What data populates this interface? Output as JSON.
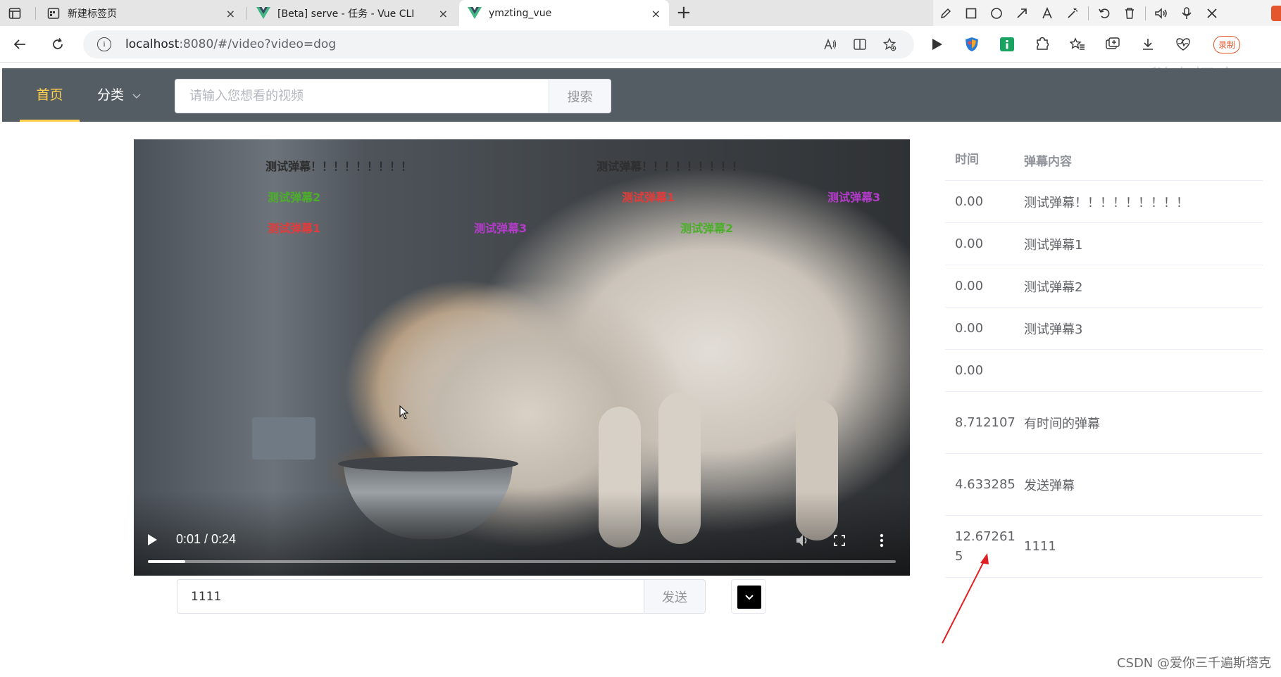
{
  "browser": {
    "tabs": [
      {
        "title": "新建标签页",
        "active": false
      },
      {
        "title": "[Beta] serve - 任务 - Vue CLI",
        "active": false
      },
      {
        "title": "ymzting_vue",
        "active": true
      }
    ],
    "close_glyph": "×",
    "new_tab_glyph": "+",
    "url_host": "localhost",
    "url_rest": ":8080/#/video?video=dog",
    "info_glyph": "i",
    "top_watermark": "稀土掘金",
    "annot_icons": [
      "pencil-icon",
      "rectangle-icon",
      "circle-icon",
      "arrow-icon",
      "text-icon",
      "magic-icon",
      "undo-icon",
      "trash-icon",
      "speaker-icon",
      "mic-icon",
      "close-icon"
    ],
    "ext_icons": [
      "play-icon",
      "shield-icon",
      "extension-green-icon",
      "puzzle-icon",
      "favorites-icon",
      "collections-icon",
      "download-icon",
      "heart-monitor-icon",
      "record-icon"
    ],
    "record_label": "录制"
  },
  "header": {
    "menu_home": "首页",
    "menu_category": "分类",
    "search_placeholder": "请输入您想看的视频",
    "search_button": "搜索",
    "bg_color": "#545c64",
    "active_color": "#ffd04b"
  },
  "video": {
    "time_display": "0:01 / 0:24",
    "progress": 0.05,
    "danmu": [
      {
        "text": "测试弹幕！！！！！！！！！",
        "color": "dark"
      },
      {
        "text": "测试弹幕！！！！！！！！！",
        "color": "dark"
      },
      {
        "text": "测试弹幕2",
        "color": "green"
      },
      {
        "text": "测试弹幕1",
        "color": "red"
      },
      {
        "text": "测试弹幕3",
        "color": "purple"
      },
      {
        "text": "测试弹幕1",
        "color": "red"
      },
      {
        "text": "测试弹幕3",
        "color": "purple"
      },
      {
        "text": "测试弹幕2",
        "color": "green"
      }
    ]
  },
  "send": {
    "input_value": "1111",
    "button": "发送",
    "color_value": "#000000"
  },
  "table": {
    "headers": {
      "time": "时间",
      "content": "弹幕内容"
    },
    "rows": [
      {
        "time": "0.00",
        "content": "测试弹幕！！！！！！！！！"
      },
      {
        "time": "0.00",
        "content": "测试弹幕1"
      },
      {
        "time": "0.00",
        "content": "测试弹幕2"
      },
      {
        "time": "0.00",
        "content": "测试弹幕3"
      },
      {
        "time": "0.00",
        "content": ""
      },
      {
        "time": "8.712107",
        "content": "有时间的弹幕"
      },
      {
        "time": "4.633285",
        "content": "发送弹幕"
      },
      {
        "time": "12.672615",
        "content": "1111"
      }
    ]
  },
  "footer_watermark": "CSDN @爱你三千遍斯塔克"
}
